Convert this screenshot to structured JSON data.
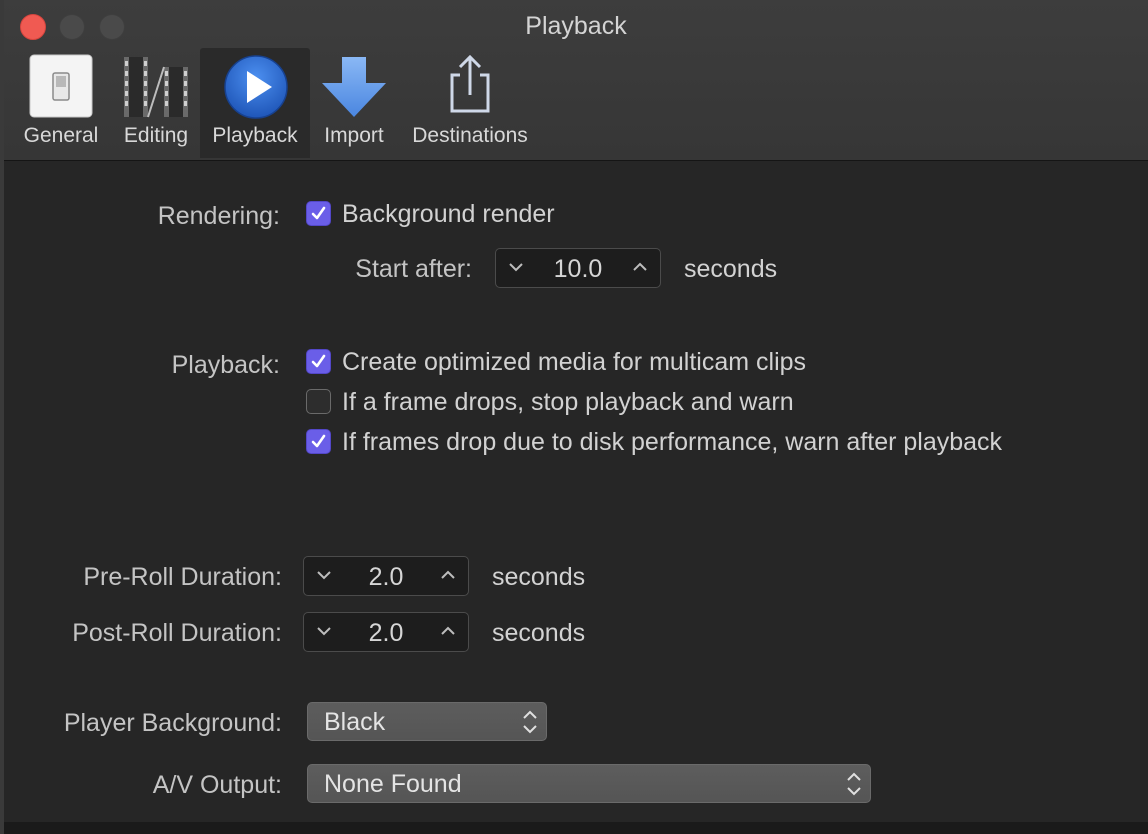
{
  "window": {
    "title": "Playback"
  },
  "toolbar": {
    "tabs": [
      {
        "label": "General",
        "icon": "switch-icon"
      },
      {
        "label": "Editing",
        "icon": "film-strip-icon"
      },
      {
        "label": "Playback",
        "icon": "play-icon",
        "active": true
      },
      {
        "label": "Import",
        "icon": "download-arrow-icon"
      },
      {
        "label": "Destinations",
        "icon": "share-icon"
      }
    ]
  },
  "rendering": {
    "label": "Rendering:",
    "background_render": {
      "label": "Background render",
      "checked": true
    },
    "start_after": {
      "label": "Start after:",
      "value": "10.0",
      "unit": "seconds"
    }
  },
  "playback": {
    "label": "Playback:",
    "options": [
      {
        "label": "Create optimized media for multicam clips",
        "checked": true
      },
      {
        "label": "If a frame drops, stop playback and warn",
        "checked": false
      },
      {
        "label": "If frames drop due to disk performance, warn after playback",
        "checked": true
      }
    ]
  },
  "pre_roll": {
    "label": "Pre-Roll Duration:",
    "value": "2.0",
    "unit": "seconds"
  },
  "post_roll": {
    "label": "Post-Roll Duration:",
    "value": "2.0",
    "unit": "seconds"
  },
  "player_background": {
    "label": "Player Background:",
    "value": "Black"
  },
  "av_output": {
    "label": "A/V Output:",
    "value": "None Found"
  },
  "colors": {
    "checkbox_accent": "#6a5ee8",
    "close_button": "#f05a52",
    "play_icon": "#2f6bd1"
  }
}
